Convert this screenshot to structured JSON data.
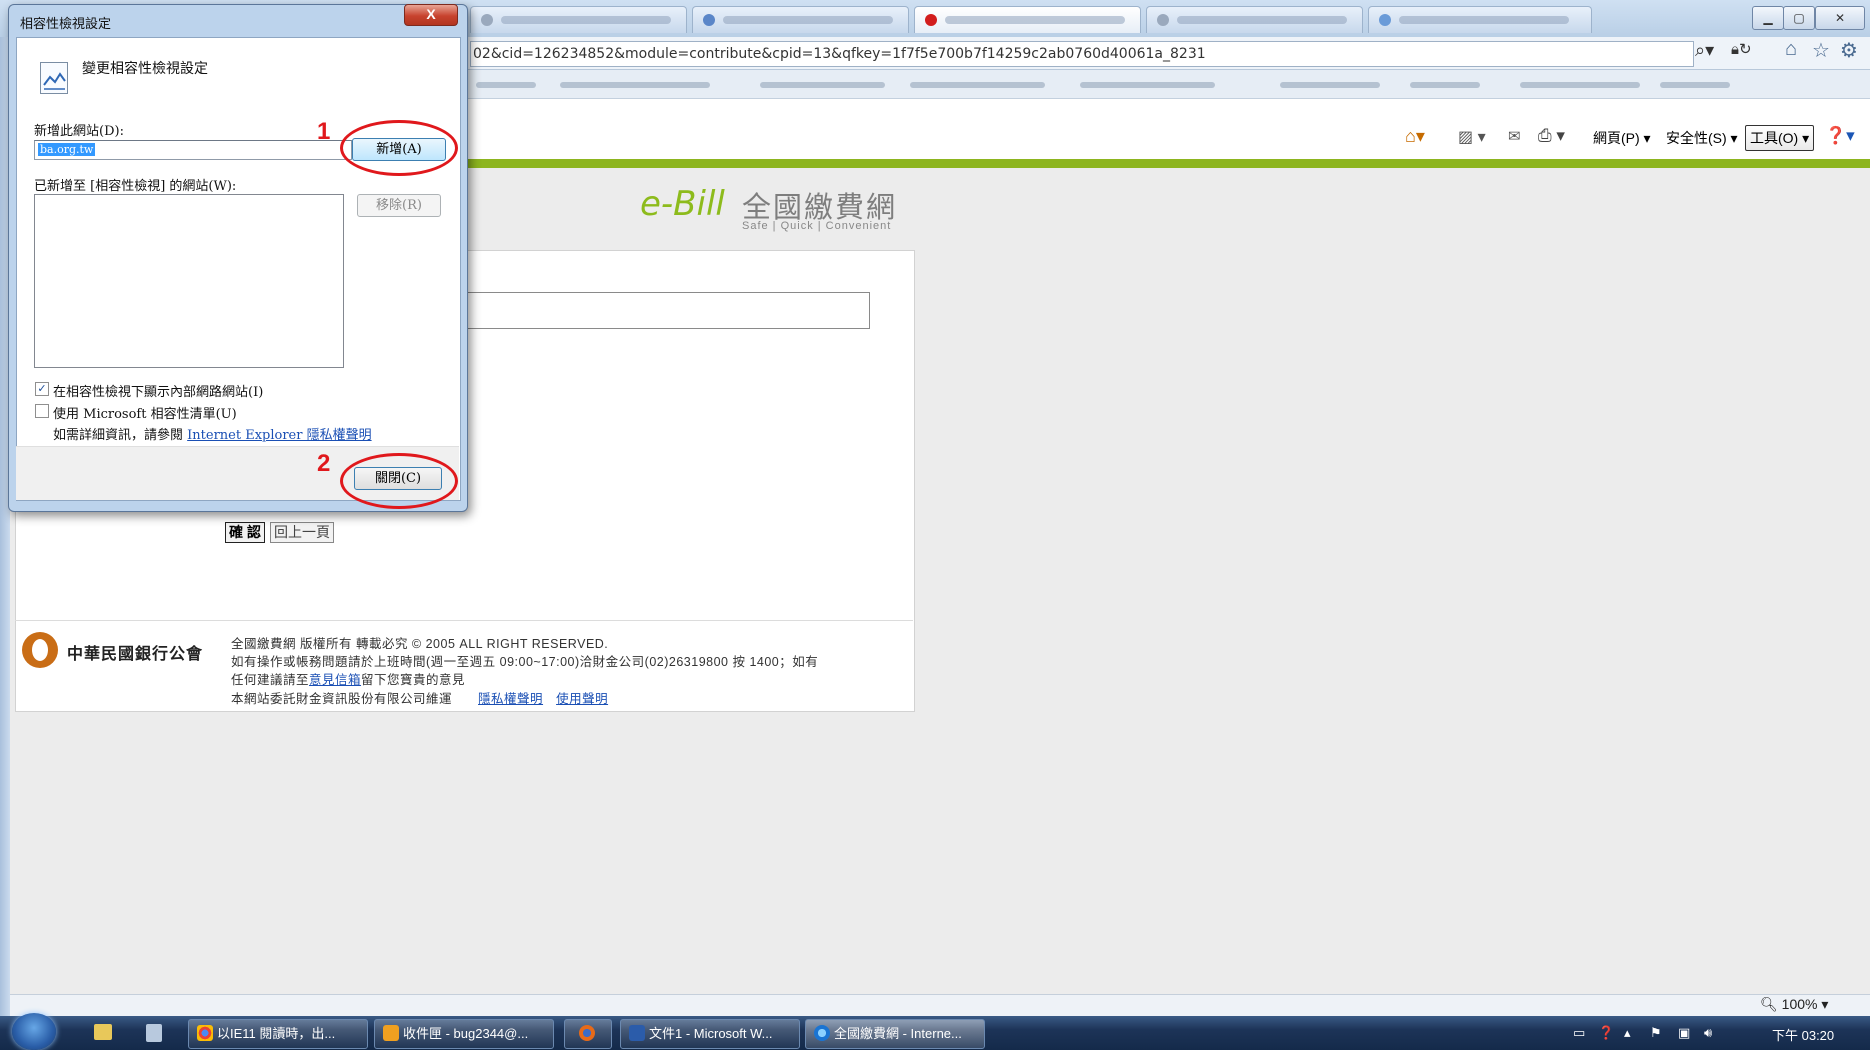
{
  "browser": {
    "address_url": "02&cid=126234852&module=contribute&cpid=13&qfkey=1f7f5e700b7f14259c2ab0760d40061a_8231",
    "commands": {
      "page_menu": "網頁(P) ▾",
      "safety_menu": "安全性(S) ▾",
      "tools_menu": "工具(O)"
    },
    "zoom": "100%"
  },
  "page": {
    "logo_e": "e-Bill",
    "logo_cn": "全國繳費網",
    "logo_sub": "Safe | Quick | Convenient",
    "confirm_button": "確 認",
    "back_button": "回上一頁",
    "footer": {
      "bank_name": "中華民國銀行公會",
      "line1": "全國繳費網 版權所有 轉載必究 © 2005 ALL RIGHT RESERVED.",
      "line2": "如有操作或帳務問題請於上班時間(週一至週五 09:00~17:00)洽財金公司(02)26319800 按 1400；如有",
      "line3_prefix": "任何建議請至",
      "line3_link": "意見信箱",
      "line3_suffix": "留下您寶貴的意見",
      "line4": "本網站委託財金資訊股份有限公司維運",
      "privacy_link": "隱私權聲明",
      "terms_link": "使用聲明"
    }
  },
  "dialog": {
    "title": "相容性檢視設定",
    "close_label": "X",
    "heading": "變更相容性檢視設定",
    "add_site_label": "新增此網站(D):",
    "add_site_value": "ba.org.tw",
    "add_button": "新增(A)",
    "list_label": "已新增至 [相容性檢視] 的網站(W):",
    "remove_button": "移除(R)",
    "checkbox1_label": "在相容性檢視下顯示內部網路網站(I)",
    "checkbox1_checked": true,
    "checkbox2_label": "使用 Microsoft 相容性清單(U)",
    "checkbox2_checked": false,
    "info_prefix": "如需詳細資訊，請參閱 ",
    "info_link": "Internet Explorer 隱私權聲明",
    "close_button": "關閉(C)"
  },
  "annotations": {
    "mark1": "1",
    "mark2": "2",
    "color": "#e0181c"
  },
  "taskbar": {
    "items": [
      "以IE11 閱讀時，出...",
      "收件匣 - bug2344@...",
      "文件1 - Microsoft W...",
      "全國繳費網 - Interne..."
    ],
    "clock": "下午 03:20"
  }
}
